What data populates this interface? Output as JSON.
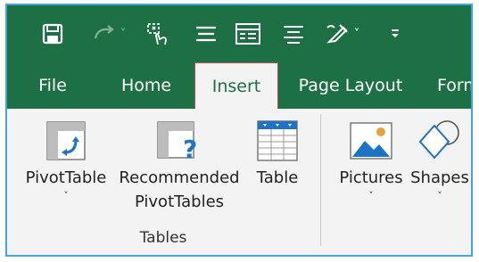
{
  "app": {
    "accent": "#1d7044",
    "frame_border": "#41a8df",
    "active_tab_border": "#c94b4b"
  },
  "qat": {
    "items": [
      {
        "icon": "save-icon"
      },
      {
        "icon": "redo-icon",
        "dropdown": "˅"
      },
      {
        "icon": "touch-mode-icon"
      },
      {
        "icon": "align-center-icon"
      },
      {
        "icon": "form-icon"
      },
      {
        "icon": "align-text-icon"
      },
      {
        "icon": "draw-icon",
        "dropdown": "˅"
      },
      {
        "icon": "customize-qat-icon"
      }
    ]
  },
  "tabs": [
    {
      "label": "File"
    },
    {
      "label": "Home"
    },
    {
      "label": "Insert",
      "active": true
    },
    {
      "label": "Page Layout"
    },
    {
      "label": "Form"
    }
  ],
  "ribbon": {
    "groups": [
      {
        "label": "Tables",
        "buttons": [
          {
            "label": "PivotTable",
            "chevron": "˅",
            "icon": "pivot-table-icon"
          },
          {
            "label1": "Recommended",
            "label2": "PivotTables",
            "icon": "recommended-pivot-tables-icon"
          },
          {
            "label": "Table",
            "icon": "table-icon"
          }
        ]
      },
      {
        "buttons": [
          {
            "label": "Pictures",
            "chevron": "˅",
            "icon": "pictures-icon"
          },
          {
            "label": "Shapes",
            "chevron": "˅",
            "icon": "shapes-icon"
          }
        ]
      }
    ]
  }
}
